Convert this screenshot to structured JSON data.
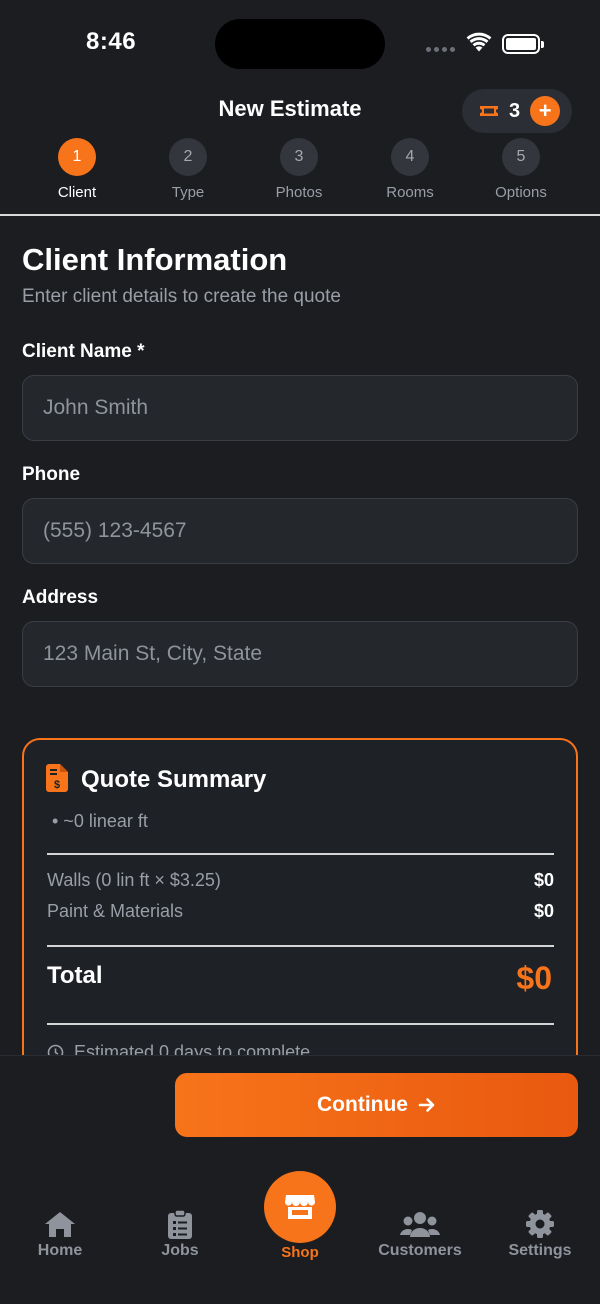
{
  "status_bar": {
    "time": "8:46"
  },
  "header": {
    "title": "New Estimate",
    "credits": "3",
    "credits_add": "+"
  },
  "stepper": [
    {
      "number": "1",
      "label": "Client",
      "active": true
    },
    {
      "number": "2",
      "label": "Type",
      "active": false
    },
    {
      "number": "3",
      "label": "Photos",
      "active": false
    },
    {
      "number": "4",
      "label": "Rooms",
      "active": false
    },
    {
      "number": "5",
      "label": "Options",
      "active": false
    }
  ],
  "form": {
    "title": "Client Information",
    "subtitle": "Enter client details to create the quote",
    "name": {
      "label": "Client Name *",
      "placeholder": "John Smith",
      "value": ""
    },
    "phone": {
      "label": "Phone",
      "placeholder": "(555) 123-4567",
      "value": ""
    },
    "address": {
      "label": "Address",
      "placeholder": "123 Main St, City, State",
      "value": ""
    }
  },
  "summary": {
    "title": "Quote Summary",
    "bullet": "• ~0 linear ft",
    "rows": [
      {
        "name": "Walls (0 lin ft × $3.25)",
        "amount": "$0"
      },
      {
        "name": "Paint & Materials",
        "amount": "$0"
      }
    ],
    "total_label": "Total",
    "total_value": "$0",
    "note": "Estimated 0 days to complete"
  },
  "actions": {
    "continue_label": "Continue",
    "continue_icon": "arrow-right-icon"
  },
  "tab_bar": [
    {
      "label": "Home",
      "icon": "home-icon",
      "active": false
    },
    {
      "label": "Jobs",
      "icon": "clipboard-list-icon",
      "active": false
    },
    {
      "label": "Shop",
      "icon": "store-icon",
      "active": true
    },
    {
      "label": "Customers",
      "icon": "users-icon",
      "active": false
    },
    {
      "label": "Settings",
      "icon": "gear-icon",
      "active": false
    }
  ],
  "colors": {
    "accent": "#f7741a",
    "background": "#1b1d21",
    "surface": "#24272c",
    "muted_text": "#9a9ea6"
  }
}
